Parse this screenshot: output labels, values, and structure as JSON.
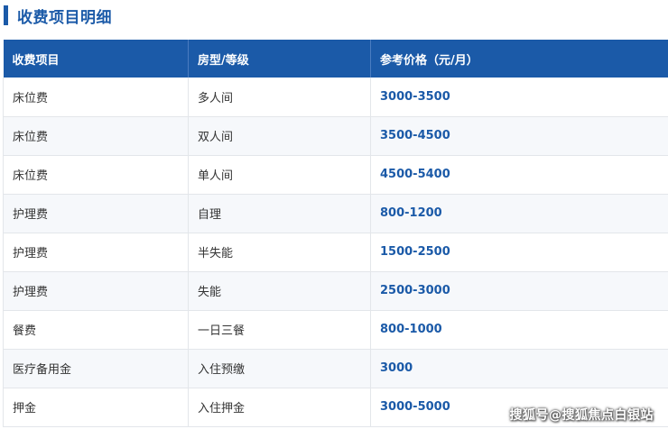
{
  "section": {
    "title": "收费项目明细"
  },
  "table": {
    "headers": [
      "收费项目",
      "房型/等级",
      "参考价格（元/月）"
    ],
    "rows": [
      [
        "床位费",
        "多人间",
        "3000-3500"
      ],
      [
        "床位费",
        "双人间",
        "3500-4500"
      ],
      [
        "床位费",
        "单人间",
        "4500-5400"
      ],
      [
        "护理费",
        "自理",
        "800-1200"
      ],
      [
        "护理费",
        "半失能",
        "1500-2500"
      ],
      [
        "护理费",
        "失能",
        "2500-3000"
      ],
      [
        "餐费",
        "一日三餐",
        "800-1000"
      ],
      [
        "医疗备用金",
        "入住预缴",
        "3000"
      ],
      [
        "押金",
        "入住押金",
        "3000-5000"
      ]
    ]
  },
  "colors": {
    "accent": "#1b5aa8",
    "header_bg": "#1b5aa8",
    "row_alt_bg": "#f6f8fb"
  },
  "watermark": {
    "text": "搜狐号@搜狐焦点白银站"
  }
}
